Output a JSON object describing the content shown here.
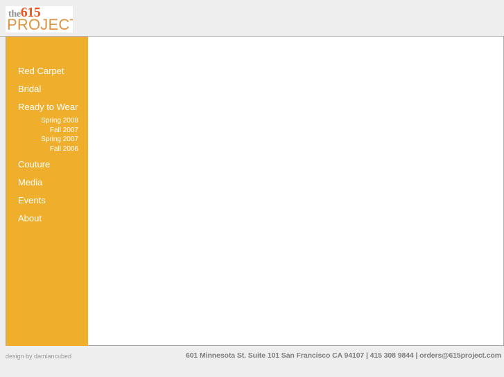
{
  "site": {
    "logo": {
      "the": "the",
      "number": "615",
      "word": "PROJECT",
      "the_color": "#8e8e8e",
      "number_color": "#e8551f",
      "word_color": "#e0933f"
    }
  },
  "theme": {
    "page_background": "#eeeeee",
    "sidebar_background": "#efae2c",
    "content_background": "#ffffff",
    "border": "#a8a8a8",
    "nav_text": "#ffffff",
    "footer_text": "#7d7d7d",
    "credit_text": "#999999"
  },
  "sidebar": {
    "items": [
      {
        "label": "Red Carpet"
      },
      {
        "label": "Bridal"
      },
      {
        "label": "Ready to Wear",
        "subitems": [
          {
            "label": "Spring 2008"
          },
          {
            "label": "Fall 2007"
          },
          {
            "label": "Spring 2007"
          },
          {
            "label": "Fall 2006"
          }
        ]
      },
      {
        "label": "Couture"
      },
      {
        "label": "Media"
      },
      {
        "label": "Events"
      },
      {
        "label": "About"
      }
    ]
  },
  "content": {
    "body": ""
  },
  "footer": {
    "credit": "design by damiancubed",
    "address": "601 Minnesota St. Suite 101 San Francisco CA 94107 | 415 308 9844 | orders@615project.com"
  }
}
